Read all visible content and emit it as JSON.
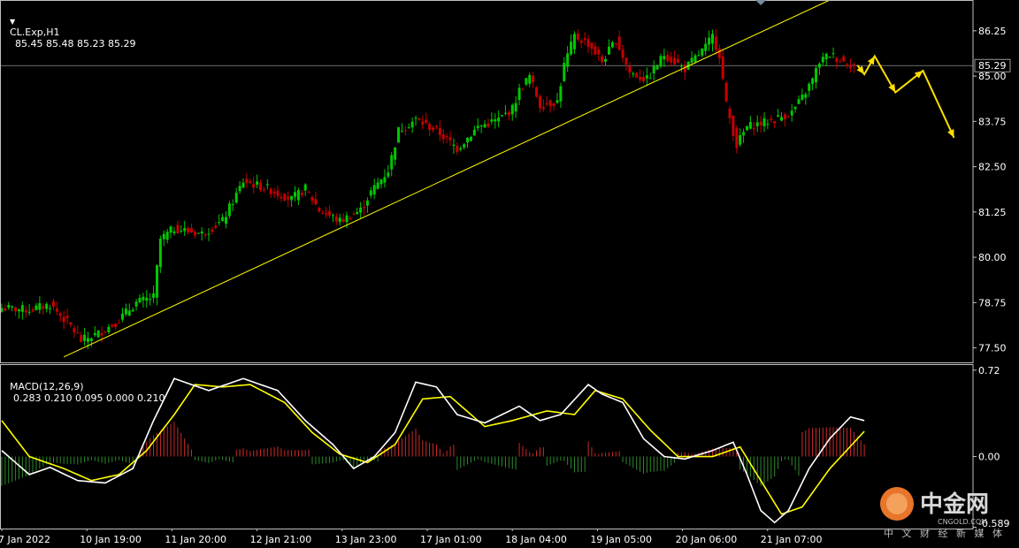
{
  "header": {
    "symbol": "CL.Exp,H1",
    "ohlc": "85.45 85.48 85.23 85.29",
    "macd_label": "MACD(12,26,9)",
    "macd_values": "0.283 0.210 0.095 0.000 0.210"
  },
  "colors": {
    "background": "#000000",
    "bull_candle": "#00c800",
    "bear_candle": "#c80000",
    "trendline": "#ffff00",
    "forecast_arrow": "#ffe000",
    "macd_line": "#ffffff",
    "signal_line": "#ffff00",
    "hist_positive": "#cc2a2a",
    "hist_negative": "#2e8b2e"
  },
  "watermark": {
    "brand": "中金网",
    "domain": "CNGOLD.COM",
    "tagline": "中 文 财 经 新 媒 体"
  },
  "chart_data": [
    {
      "type": "candlestick",
      "title": "CL.Exp,H1",
      "price_ticks": [
        "86.25",
        "85.00",
        "83.75",
        "82.50",
        "81.25",
        "80.00",
        "78.75",
        "77.50"
      ],
      "price_tick_values": [
        86.25,
        85.0,
        83.75,
        82.5,
        81.25,
        80.0,
        78.75,
        77.5
      ],
      "current_price": 85.29,
      "current_price_label": "85.29",
      "ylim": [
        77.1,
        87.1
      ],
      "time_labels": [
        "7 Jan 2022",
        "10 Jan 19:00",
        "11 Jan 20:00",
        "12 Jan 21:00",
        "13 Jan 23:00",
        "17 Jan 01:00",
        "18 Jan 04:00",
        "19 Jan 05:00",
        "20 Jan 06:00",
        "21 Jan 07:00"
      ],
      "close_path": [
        [
          0,
          78.6
        ],
        [
          8,
          78.55
        ],
        [
          14,
          78.7
        ],
        [
          20,
          78.1
        ],
        [
          23,
          77.7
        ],
        [
          28,
          77.9
        ],
        [
          33,
          78.2
        ],
        [
          39,
          78.75
        ],
        [
          44,
          78.9
        ],
        [
          46,
          80.5
        ],
        [
          50,
          80.8
        ],
        [
          58,
          80.65
        ],
        [
          64,
          81.0
        ],
        [
          70,
          82.1
        ],
        [
          77,
          81.9
        ],
        [
          84,
          81.6
        ],
        [
          88,
          81.9
        ],
        [
          92,
          81.3
        ],
        [
          98,
          81.0
        ],
        [
          104,
          81.3
        ],
        [
          107,
          81.8
        ],
        [
          112,
          82.4
        ],
        [
          115,
          83.5
        ],
        [
          120,
          83.8
        ],
        [
          126,
          83.5
        ],
        [
          132,
          83.0
        ],
        [
          138,
          83.6
        ],
        [
          144,
          83.8
        ],
        [
          148,
          84.1
        ],
        [
          150,
          84.6
        ],
        [
          153,
          85.0
        ],
        [
          156,
          84.2
        ],
        [
          161,
          84.3
        ],
        [
          163,
          85.3
        ],
        [
          166,
          86.1
        ],
        [
          170,
          85.9
        ],
        [
          174,
          85.4
        ],
        [
          178,
          86.0
        ],
        [
          182,
          85.1
        ],
        [
          187,
          84.9
        ],
        [
          192,
          85.6
        ],
        [
          198,
          85.2
        ],
        [
          204,
          85.8
        ],
        [
          206,
          86.1
        ],
        [
          208,
          85.6
        ],
        [
          210,
          84.2
        ],
        [
          213,
          83.1
        ],
        [
          216,
          83.6
        ],
        [
          220,
          83.7
        ],
        [
          224,
          83.8
        ],
        [
          229,
          84.0
        ],
        [
          232,
          84.4
        ],
        [
          235,
          84.9
        ],
        [
          237,
          85.4
        ],
        [
          240,
          85.6
        ],
        [
          244,
          85.4
        ],
        [
          247,
          85.29
        ]
      ],
      "trendline": {
        "start": [
          18,
          77.25
        ],
        "end": [
          240,
          87.1
        ]
      },
      "forecast_path": [
        [
          248,
          85.3
        ],
        [
          250,
          85.05
        ],
        [
          253,
          85.55
        ],
        [
          259,
          84.55
        ],
        [
          267,
          85.15
        ],
        [
          276,
          83.3
        ]
      ]
    },
    {
      "type": "macd",
      "title": "MACD(12,26,9)",
      "ticks": [
        "0.72",
        "0.00",
        "-0.589"
      ],
      "tick_values": [
        0.72,
        0.0,
        -0.589
      ],
      "ylim": [
        -0.6,
        0.77
      ],
      "macd_path": [
        [
          0,
          0.05
        ],
        [
          8,
          -0.15
        ],
        [
          14,
          -0.09
        ],
        [
          22,
          -0.2
        ],
        [
          30,
          -0.22
        ],
        [
          38,
          -0.1
        ],
        [
          44,
          0.3
        ],
        [
          50,
          0.65
        ],
        [
          60,
          0.55
        ],
        [
          70,
          0.65
        ],
        [
          80,
          0.55
        ],
        [
          88,
          0.3
        ],
        [
          96,
          0.1
        ],
        [
          102,
          -0.1
        ],
        [
          108,
          0.0
        ],
        [
          114,
          0.2
        ],
        [
          120,
          0.62
        ],
        [
          126,
          0.58
        ],
        [
          132,
          0.35
        ],
        [
          140,
          0.28
        ],
        [
          150,
          0.42
        ],
        [
          156,
          0.3
        ],
        [
          162,
          0.35
        ],
        [
          170,
          0.6
        ],
        [
          174,
          0.52
        ],
        [
          180,
          0.45
        ],
        [
          186,
          0.15
        ],
        [
          192,
          0.0
        ],
        [
          198,
          -0.02
        ],
        [
          206,
          0.05
        ],
        [
          212,
          0.12
        ],
        [
          216,
          -0.15
        ],
        [
          220,
          -0.45
        ],
        [
          224,
          -0.55
        ],
        [
          228,
          -0.45
        ],
        [
          234,
          -0.1
        ],
        [
          240,
          0.15
        ],
        [
          246,
          0.33
        ],
        [
          250,
          0.3
        ]
      ],
      "signal_path": [
        [
          0,
          0.3
        ],
        [
          8,
          0.0
        ],
        [
          18,
          -0.1
        ],
        [
          26,
          -0.2
        ],
        [
          34,
          -0.15
        ],
        [
          42,
          0.05
        ],
        [
          50,
          0.35
        ],
        [
          56,
          0.6
        ],
        [
          64,
          0.58
        ],
        [
          72,
          0.6
        ],
        [
          82,
          0.45
        ],
        [
          90,
          0.2
        ],
        [
          98,
          0.02
        ],
        [
          106,
          -0.05
        ],
        [
          114,
          0.1
        ],
        [
          122,
          0.48
        ],
        [
          130,
          0.5
        ],
        [
          140,
          0.25
        ],
        [
          148,
          0.3
        ],
        [
          158,
          0.38
        ],
        [
          166,
          0.35
        ],
        [
          172,
          0.55
        ],
        [
          180,
          0.48
        ],
        [
          188,
          0.22
        ],
        [
          196,
          0.0
        ],
        [
          206,
          0.0
        ],
        [
          214,
          0.08
        ],
        [
          220,
          -0.2
        ],
        [
          226,
          -0.48
        ],
        [
          232,
          -0.42
        ],
        [
          240,
          -0.1
        ],
        [
          250,
          0.21
        ]
      ],
      "histogram_sign_runs": [
        {
          "from": 0,
          "to": 40,
          "sign": "negative"
        },
        {
          "from": 40,
          "to": 56,
          "sign": "positive"
        },
        {
          "from": 56,
          "to": 68,
          "sign": "negative"
        },
        {
          "from": 68,
          "to": 90,
          "sign": "positive"
        },
        {
          "from": 90,
          "to": 110,
          "sign": "negative"
        },
        {
          "from": 110,
          "to": 132,
          "sign": "positive"
        },
        {
          "from": 132,
          "to": 150,
          "sign": "negative"
        },
        {
          "from": 150,
          "to": 158,
          "sign": "positive"
        },
        {
          "from": 158,
          "to": 170,
          "sign": "negative"
        },
        {
          "from": 170,
          "to": 180,
          "sign": "positive"
        },
        {
          "from": 180,
          "to": 196,
          "sign": "negative"
        },
        {
          "from": 196,
          "to": 214,
          "sign": "positive"
        },
        {
          "from": 214,
          "to": 232,
          "sign": "negative"
        },
        {
          "from": 232,
          "to": 252,
          "sign": "positive"
        }
      ]
    }
  ]
}
